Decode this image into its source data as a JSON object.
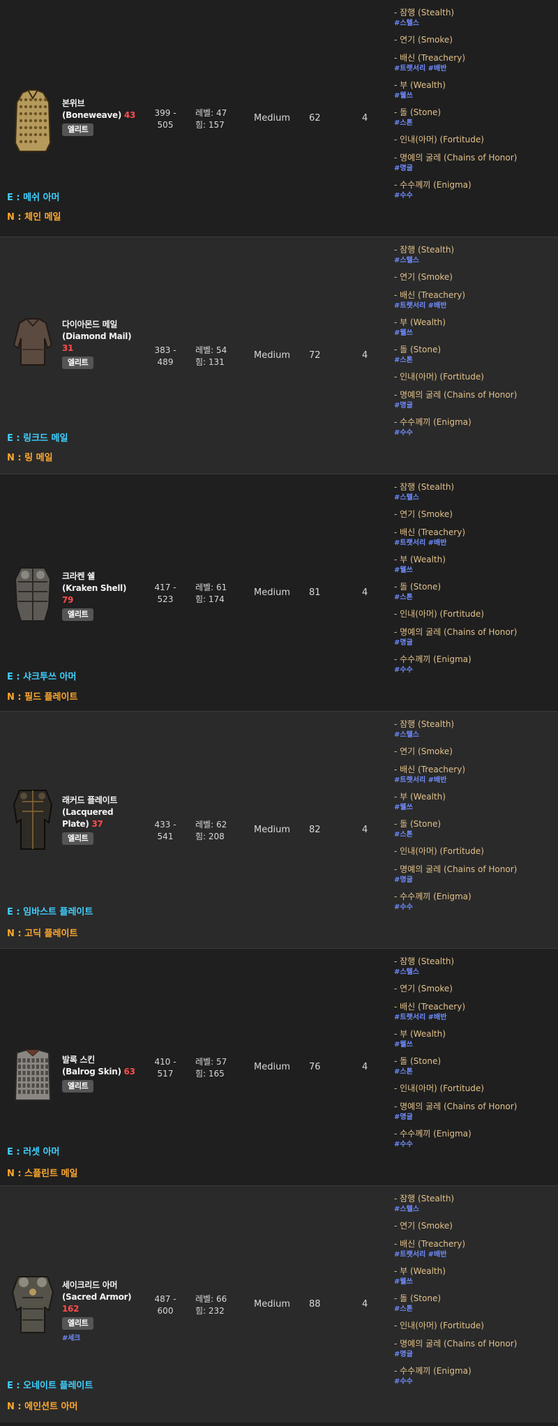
{
  "runewords": [
    {
      "name": "- 잠행 (Stealth)",
      "tags": "#스텔스"
    },
    {
      "name": "- 연기 (Smoke)",
      "tags": ""
    },
    {
      "name": "- 배신 (Treachery)",
      "tags": "#트랫서리 #배반"
    },
    {
      "name": "- 부 (Wealth)",
      "tags": "#웰쓰"
    },
    {
      "name": "- 돌 (Stone)",
      "tags": "#스톤"
    },
    {
      "name": "- 인내(아머) (Fortitude)",
      "tags": ""
    },
    {
      "name": "- 명예의 굴레 (Chains of Honor)",
      "tags": "#명굴"
    },
    {
      "name": "- 수수께끼 (Enigma)",
      "tags": "#수수"
    }
  ],
  "items": [
    {
      "name_ko": "본위브",
      "name_en": "(Boneweave)",
      "level": "43",
      "badge": "엘리트",
      "tag": "",
      "def_min": "399 -",
      "def_max": "505",
      "req_level": "레벨: 47",
      "req_str": "힘: 157",
      "size": "Medium",
      "durability": "62",
      "sockets": "4",
      "exceptional": "E : 메쉬 아머",
      "normal": "N : 체인 메일"
    },
    {
      "name_ko": "다이아몬드 메일",
      "name_en": "(Diamond Mail)",
      "level": "31",
      "badge": "엘리트",
      "tag": "",
      "def_min": "383 -",
      "def_max": "489",
      "req_level": "레벨: 54",
      "req_str": "힘: 131",
      "size": "Medium",
      "durability": "72",
      "sockets": "4",
      "exceptional": "E : 링크드 메일",
      "normal": "N : 링 메일"
    },
    {
      "name_ko": "크라켄 쉘",
      "name_en": "(Kraken Shell)",
      "level": "79",
      "badge": "엘리트",
      "tag": "",
      "def_min": "417 -",
      "def_max": "523",
      "req_level": "레벨: 61",
      "req_str": "힘: 174",
      "size": "Medium",
      "durability": "81",
      "sockets": "4",
      "exceptional": "E : 샤크투쓰 아머",
      "normal": "N : 필드 플레이트"
    },
    {
      "name_ko": "래커드 플레이트",
      "name_en": "(Lacquered Plate)",
      "level": "37",
      "badge": "엘리트",
      "tag": "",
      "def_min": "433 -",
      "def_max": "541",
      "req_level": "레벨: 62",
      "req_str": "힘: 208",
      "size": "Medium",
      "durability": "82",
      "sockets": "4",
      "exceptional": "E : 임바스트 플레이트",
      "normal": "N : 고딕 플레이트"
    },
    {
      "name_ko": "발록 스킨",
      "name_en": "(Balrog Skin)",
      "level": "63",
      "badge": "엘리트",
      "tag": "",
      "def_min": "410 -",
      "def_max": "517",
      "req_level": "레벨: 57",
      "req_str": "힘: 165",
      "size": "Medium",
      "durability": "76",
      "sockets": "4",
      "exceptional": "E : 러셋 아머",
      "normal": "N : 스플린트 메일"
    },
    {
      "name_ko": "세이크리드 아머",
      "name_en": "(Sacred Armor)",
      "level": "162",
      "badge": "엘리트",
      "tag": "#세크",
      "def_min": "487 -",
      "def_max": "600",
      "req_level": "레벨: 66",
      "req_str": "힘: 232",
      "size": "Medium",
      "durability": "88",
      "sockets": "4",
      "exceptional": "E : 오네이트 플레이트",
      "normal": "N : 에인션트 아머"
    }
  ],
  "colors": {
    "exceptional": "#3fd0ff",
    "normal": "#ffa82e",
    "level": "#ff4d4d",
    "runeword": "#e2c18a",
    "tag": "#6f8cff"
  },
  "icons": [
    "boneweave-armor-icon",
    "diamond-mail-icon",
    "kraken-shell-icon",
    "lacquered-plate-icon",
    "balrog-skin-icon",
    "sacred-armor-icon"
  ]
}
